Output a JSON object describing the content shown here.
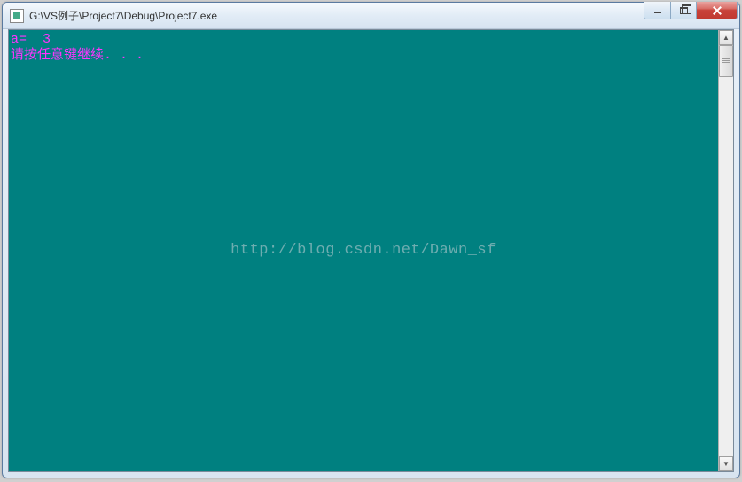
{
  "window": {
    "title": "G:\\VS例子\\Project7\\Debug\\Project7.exe"
  },
  "console": {
    "line1": "a=  3",
    "line2": "请按任意键继续. . ."
  },
  "watermark": "http://blog.csdn.net/Dawn_sf"
}
